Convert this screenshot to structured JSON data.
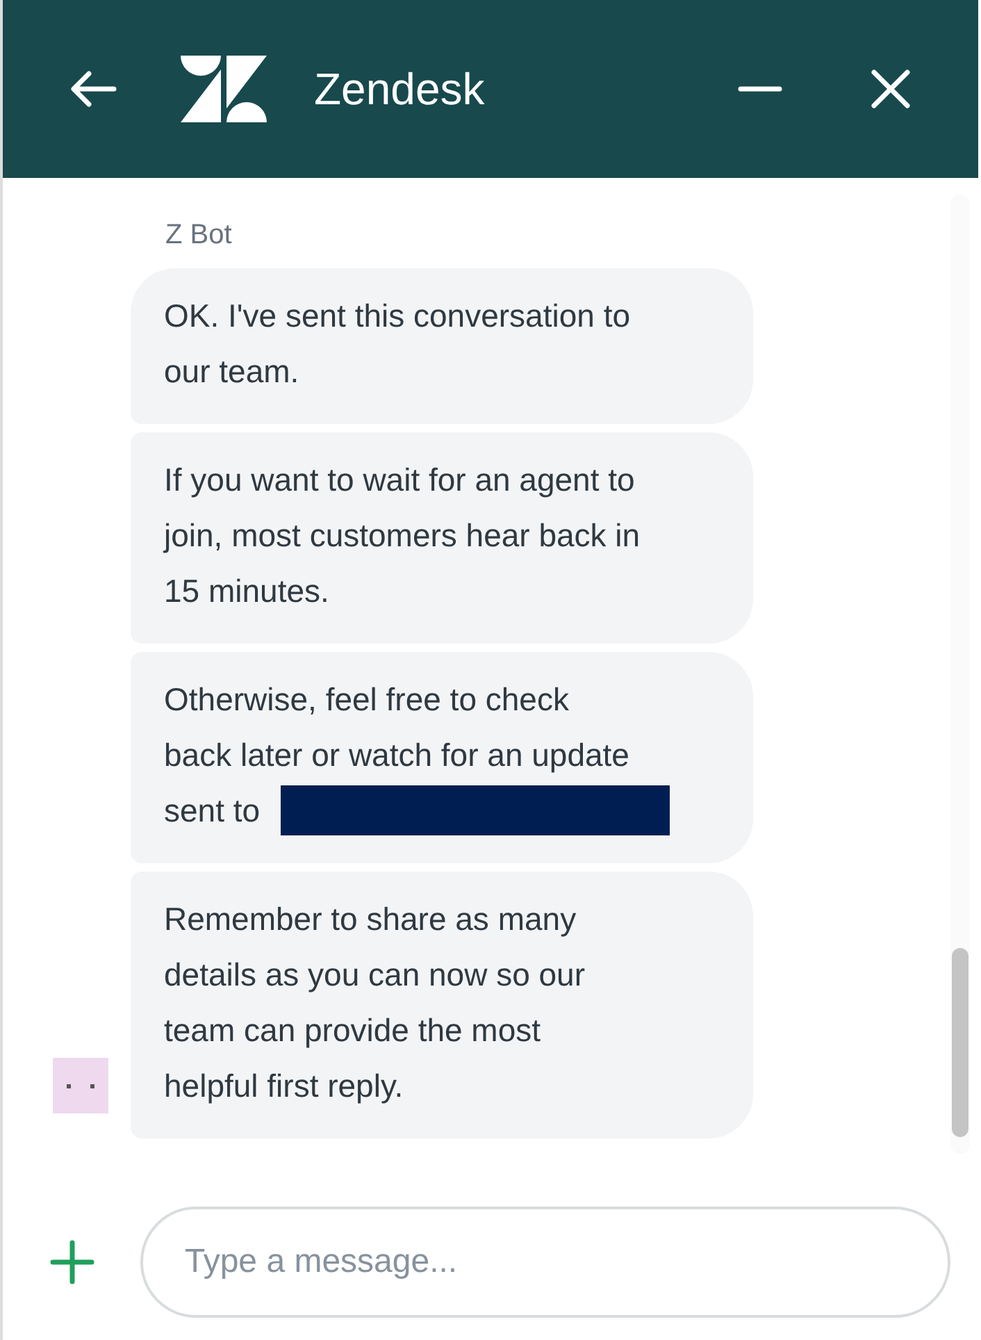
{
  "header": {
    "title": "Zendesk"
  },
  "conversation": {
    "sender": "Z Bot",
    "messages": [
      {
        "lines": [
          "OK. I've sent this conversation to",
          "our team."
        ],
        "redacted": false
      },
      {
        "lines": [
          "If you want to wait for an agent to",
          "join, most customers hear back in",
          "15 minutes."
        ],
        "redacted": false
      },
      {
        "lines": [
          "Otherwise, feel free to check",
          "back later or watch for an update",
          "sent to"
        ],
        "redacted": true
      },
      {
        "lines": [
          "Remember to share as many",
          "details as you can now so our",
          "team can provide the most",
          "helpful first reply."
        ],
        "redacted": false
      }
    ]
  },
  "composer": {
    "placeholder": "Type a message..."
  }
}
